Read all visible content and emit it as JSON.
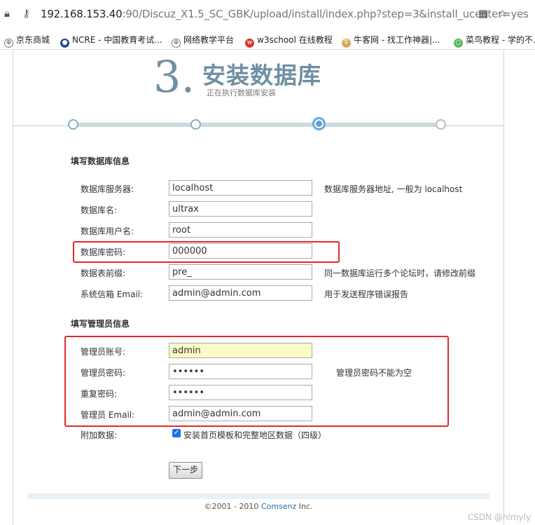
{
  "browser": {
    "url_host": "192.168.153.40",
    "url_rest": ":90/Discuz_X1.5_SC_GBK/upload/install/index.php?step=3&install_ucenter=yes",
    "bookmarks": [
      {
        "label": "京东商城"
      },
      {
        "label": "NCRE - 中国教育考试..."
      },
      {
        "label": "网络教学平台"
      },
      {
        "label": "w3school 在线教程"
      },
      {
        "label": "牛客网 - 找工作神器|..."
      },
      {
        "label": "菜鸟教程 - 学的不..."
      }
    ]
  },
  "header": {
    "step_number": "3.",
    "title": "安装数据库",
    "subtitle": "正在执行数据库安装"
  },
  "progress": {
    "steps": 4,
    "current_step": 3
  },
  "db_section": {
    "title": "填写数据库信息",
    "fields": [
      {
        "label": "数据库服务器:",
        "value": "localhost",
        "note": "数据库服务器地址, 一般为 localhost"
      },
      {
        "label": "数据库名:",
        "value": "ultrax",
        "note": ""
      },
      {
        "label": "数据库用户名:",
        "value": "root",
        "note": ""
      },
      {
        "label": "数据库密码:",
        "value": "000000",
        "note": ""
      },
      {
        "label": "数据表前缀:",
        "value": "pre_",
        "note": "同一数据库运行多个论坛时，请修改前缀"
      },
      {
        "label": "系统信箱 Email:",
        "value": "admin@admin.com",
        "note": "用于发送程序错误报告"
      }
    ]
  },
  "admin_section": {
    "title": "填写管理员信息",
    "fields": [
      {
        "label": "管理员账号:",
        "value": "admin"
      },
      {
        "label": "管理员密码:",
        "value": "••••••",
        "note": "管理员密码不能为空"
      },
      {
        "label": "重复密码:",
        "value": "••••••"
      },
      {
        "label": "管理员 Email:",
        "value": "admin@admin.com"
      }
    ]
  },
  "extra": {
    "label": "附加数据:",
    "checkbox_label": "安装首页模板和完整地区数据（四级）",
    "checked": true
  },
  "next_button": "下一步",
  "footer": {
    "copy_pre": "©2001 - 2010 ",
    "company": "Comsenz",
    "copy_post": " Inc."
  },
  "watermark": "CSDN @hlmyly"
}
